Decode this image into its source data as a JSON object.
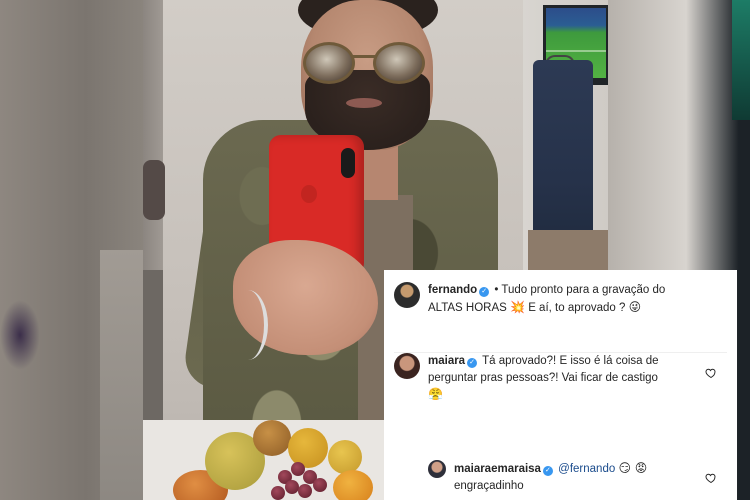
{
  "comments": [
    {
      "username": "fernando",
      "verified": true,
      "text_part1": "• Tudo pronto para a gravação do ALTAS HORAS",
      "emoji1": "💥",
      "text_part2": "E aí, to aprovado ?",
      "emoji2": "😜"
    },
    {
      "username": "maiara",
      "verified": true,
      "text": "Tá aprovado?! E isso é lá coisa de perguntar pras pessoas?! Vai ficar de castigo",
      "emoji": "😤"
    },
    {
      "username": "maiaraemaraisa",
      "verified": true,
      "mention": "@fernando",
      "emojis": "😏 😡",
      "text": "engraçadinho"
    }
  ],
  "icons": {
    "like": "heart-outline-icon",
    "verified": "verified-badge-icon"
  },
  "colors": {
    "verified_blue": "#3897f0",
    "mention_blue": "#1a4b8c",
    "phone_red": "#d92a26"
  }
}
